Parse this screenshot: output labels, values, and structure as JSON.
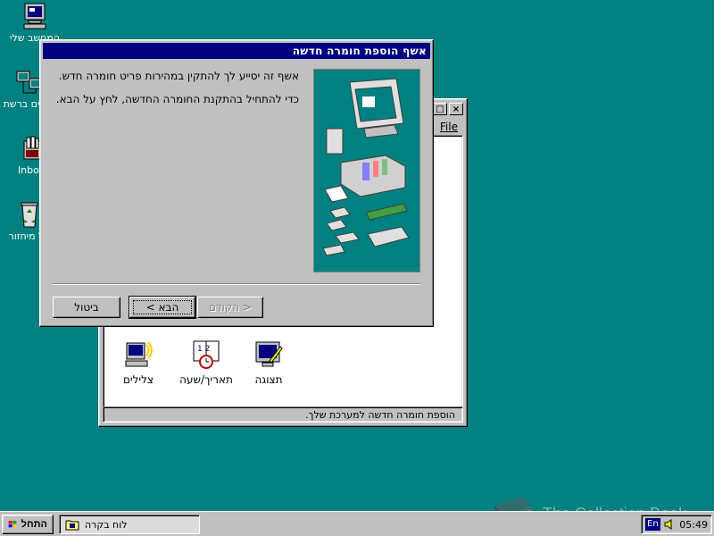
{
  "desktop": {
    "icons": [
      {
        "label": "המחשב שלי",
        "icon": "my-computer-icon"
      },
      {
        "label": "שכנים ברשת",
        "icon": "network-neighborhood-icon"
      },
      {
        "label": "Inbox",
        "icon": "inbox-icon"
      },
      {
        "label": "סל מיחזור",
        "icon": "recycle-bin-icon"
      }
    ]
  },
  "control_panel": {
    "menu": {
      "file": "File"
    },
    "items": [
      {
        "label": "תצוגה",
        "icon": "display-icon"
      },
      {
        "label": "תאריך/שעה",
        "icon": "date-time-icon"
      },
      {
        "label": "צלילים",
        "icon": "sounds-icon"
      }
    ],
    "status": "הוספת חומרה חדשה למערכת שלך."
  },
  "wizard": {
    "title": "אשף הוספת חומרה חדשה",
    "paragraph1": "אשף זה יסייע לך להתקין במהירות פריט חומרה חדש.",
    "paragraph2": "כדי להתחיל בהתקנת החומרה החדשה, לחץ על הבא.",
    "back_label": "< הקודם",
    "next_label": "הבא >",
    "cancel_label": "ביטול"
  },
  "taskbar": {
    "start_label": "התחל",
    "task_label": "לוח בקרה",
    "lang": "En",
    "time": "05:49"
  },
  "watermark": {
    "text": "The Collection Book"
  },
  "colors": {
    "desktop": "#008080",
    "titlebar": "#000080",
    "face": "#c0c0c0"
  }
}
